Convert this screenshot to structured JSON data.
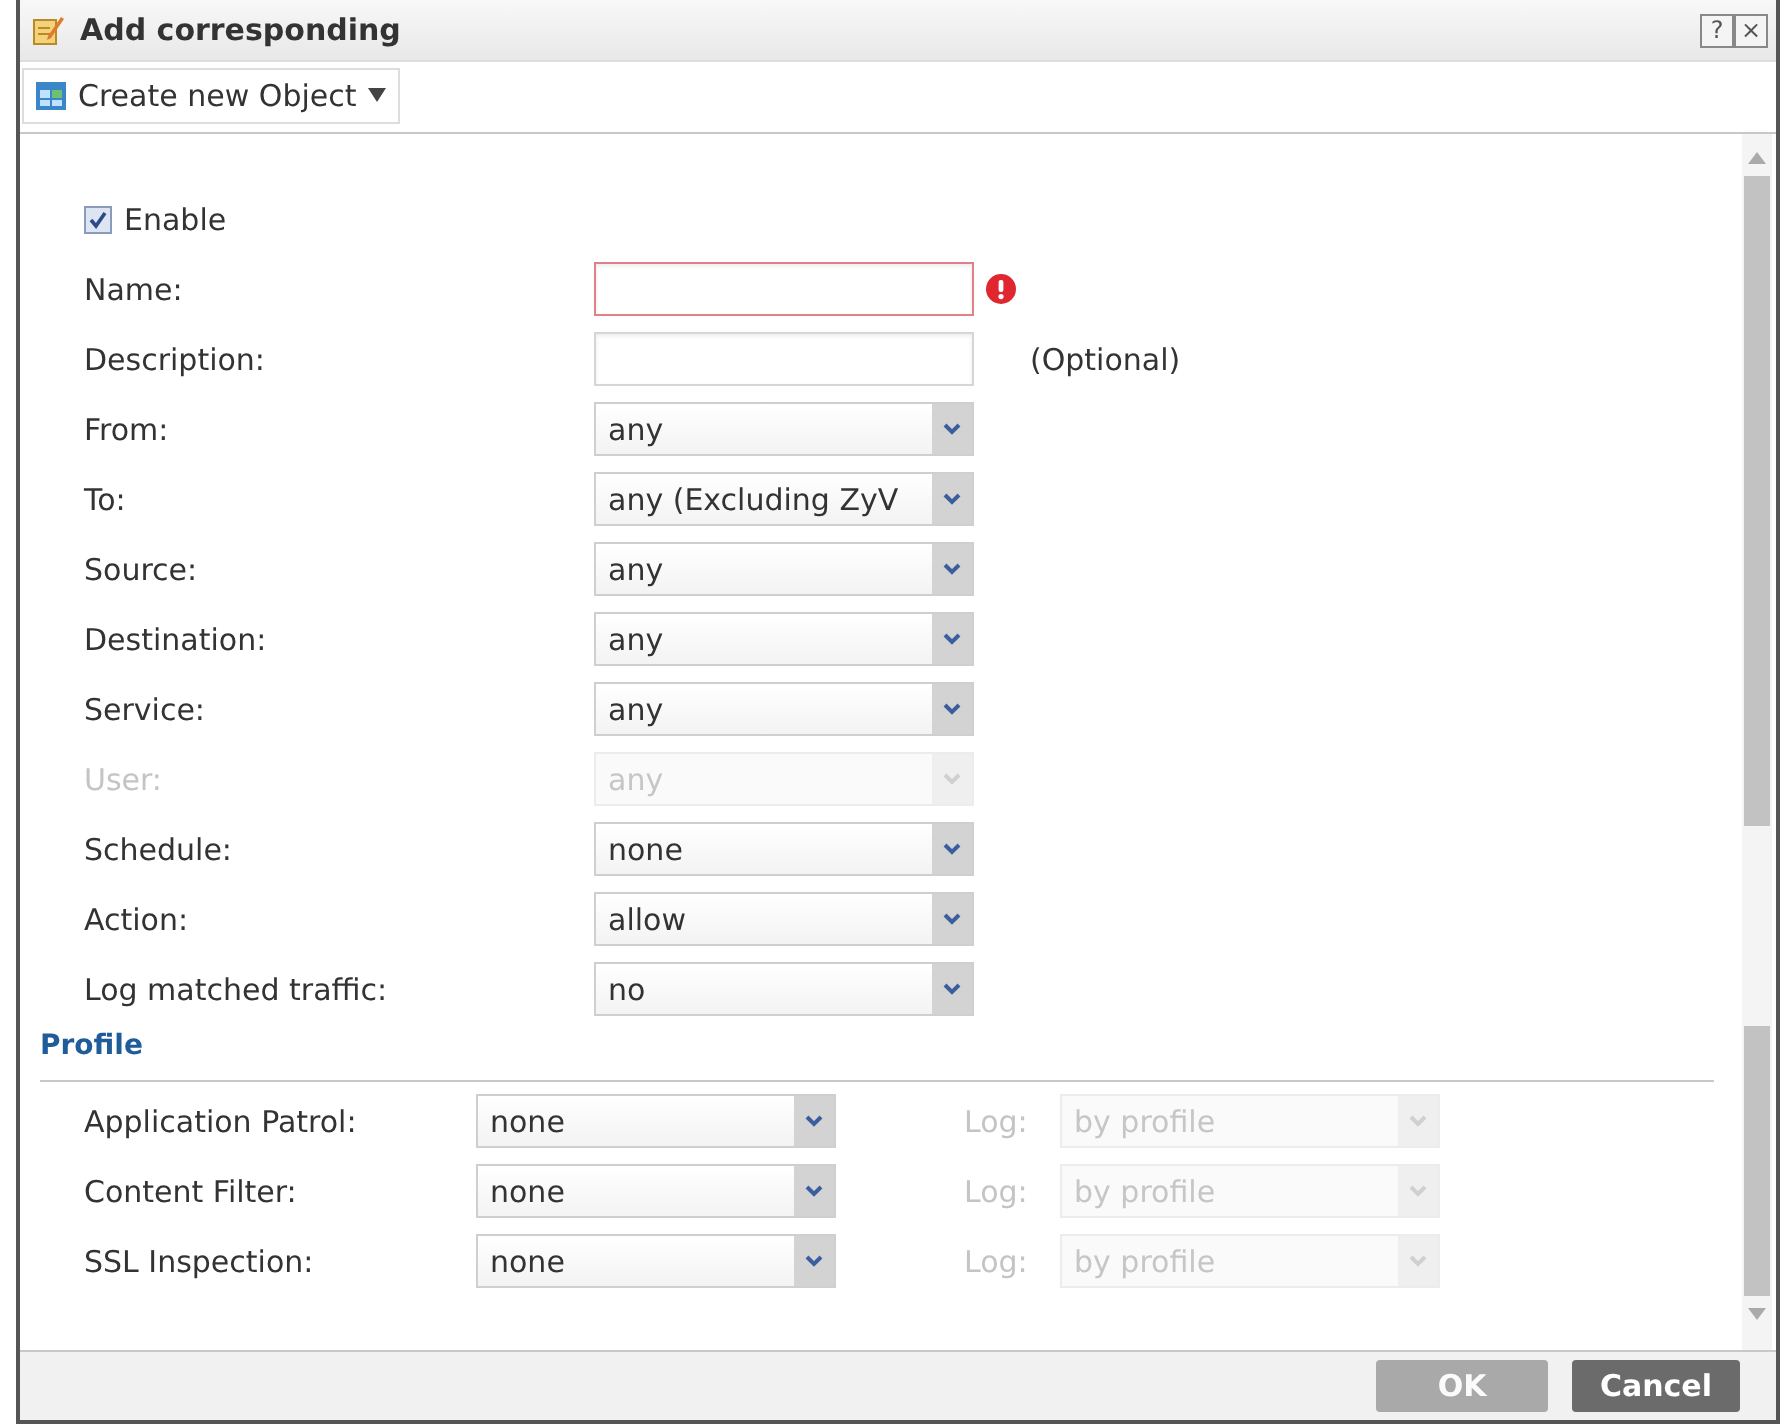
{
  "window": {
    "title": "Add corresponding",
    "controls": [
      "?",
      "×"
    ]
  },
  "toolbar": {
    "menu_button": {
      "label": "Create new Object"
    }
  },
  "form": {
    "enable": {
      "label": "Enable",
      "checked": true
    },
    "fields": [
      {
        "kind": "text",
        "label": "Name:",
        "error": true
      },
      {
        "kind": "text",
        "label": "Description:",
        "error": false,
        "note": "(Optional)"
      },
      {
        "kind": "select",
        "label": "From:",
        "value": "any",
        "disabled": false
      },
      {
        "kind": "select",
        "label": "To:",
        "value": "any (Excluding ZyV",
        "disabled": false
      },
      {
        "kind": "select",
        "label": "Source:",
        "value": "any",
        "disabled": false
      },
      {
        "kind": "select",
        "label": "Destination:",
        "value": "any",
        "disabled": false
      },
      {
        "kind": "select",
        "label": "Service:",
        "value": "any",
        "disabled": false
      },
      {
        "kind": "select",
        "label": "User:",
        "value": "any",
        "disabled": true
      },
      {
        "kind": "select",
        "label": "Schedule:",
        "value": "none",
        "disabled": false
      },
      {
        "kind": "select",
        "label": "Action:",
        "value": "allow",
        "disabled": false
      },
      {
        "kind": "select",
        "label": "Log matched traffic:",
        "value": "no",
        "disabled": false
      }
    ]
  },
  "profile": {
    "title": "Profile",
    "rows": [
      {
        "label": "Application Patrol:",
        "value": "none",
        "log": {
          "label": "Log:",
          "value": "by profile",
          "disabled": true
        }
      },
      {
        "label": "Content Filter:",
        "value": "none",
        "log": {
          "label": "Log:",
          "value": "by profile",
          "disabled": true
        }
      },
      {
        "label": "SSL Inspection:",
        "value": "none",
        "log": {
          "label": "Log:",
          "value": "by profile",
          "disabled": true
        }
      }
    ]
  },
  "buttons": [
    {
      "kind": "ok",
      "label": "OK",
      "disabled": true
    },
    {
      "kind": "cancel",
      "label": "Cancel",
      "disabled": false
    }
  ]
}
